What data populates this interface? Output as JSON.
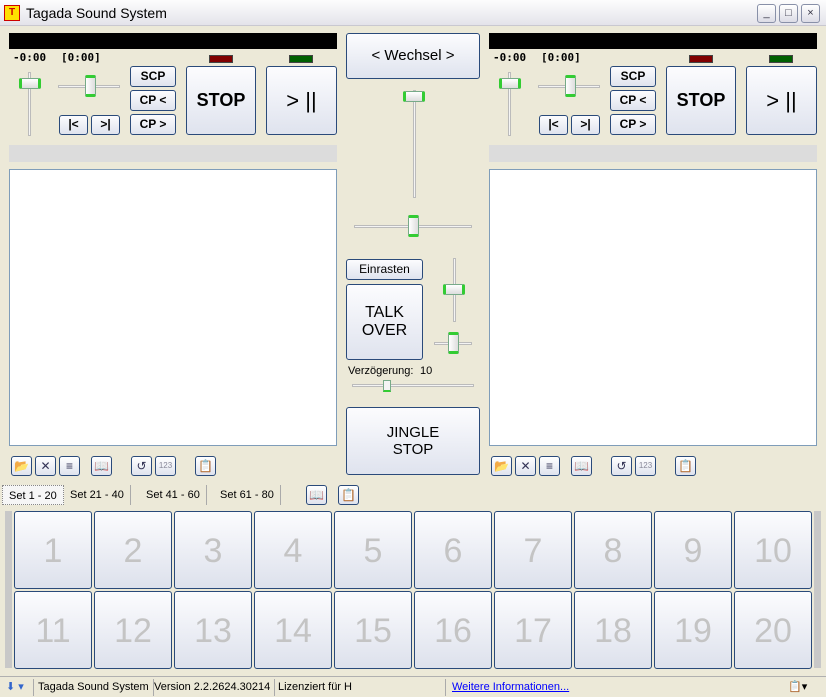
{
  "window": {
    "title": "Tagada Sound System",
    "app_icon": "TSS",
    "minimize": "_",
    "maximize": "□",
    "close": "×"
  },
  "decks": [
    {
      "time": "-0:00",
      "total": "[0:00]",
      "scp": "SCP",
      "cp_back": "CP <",
      "cp_fwd": "CP >",
      "prev": "|<",
      "next": ">|",
      "stop": "STOP",
      "play": "> ||",
      "led_stop": "#800000",
      "led_play": "#006000",
      "volume": 0.9,
      "pitch": 0.5
    },
    {
      "time": "-0:00",
      "total": "[0:00]",
      "scp": "SCP",
      "cp_back": "CP <",
      "cp_fwd": "CP >",
      "prev": "|<",
      "next": ">|",
      "stop": "STOP",
      "play": "> ||",
      "led_stop": "#800000",
      "led_play": "#006000",
      "volume": 0.9,
      "pitch": 0.5
    }
  ],
  "center": {
    "wechsel": "< Wechsel >",
    "einrasten": "Einrasten",
    "talk_over": "TALK OVER",
    "delay_label": "Verzögerung:",
    "delay_value": "10",
    "jingle_stop": "JINGLE STOP"
  },
  "tabs": [
    "Set 1 - 20",
    "Set 21 - 40",
    "Set 41 - 60",
    "Set 61 - 80"
  ],
  "jingles": [
    "1",
    "2",
    "3",
    "4",
    "5",
    "6",
    "7",
    "8",
    "9",
    "10",
    "11",
    "12",
    "13",
    "14",
    "15",
    "16",
    "17",
    "18",
    "19",
    "20"
  ],
  "statusbar": {
    "app": "Tagada Sound System",
    "version": "Version 2.2.2624.30214",
    "license": "Lizenziert für H",
    "link": "Weitere Informationen..."
  }
}
